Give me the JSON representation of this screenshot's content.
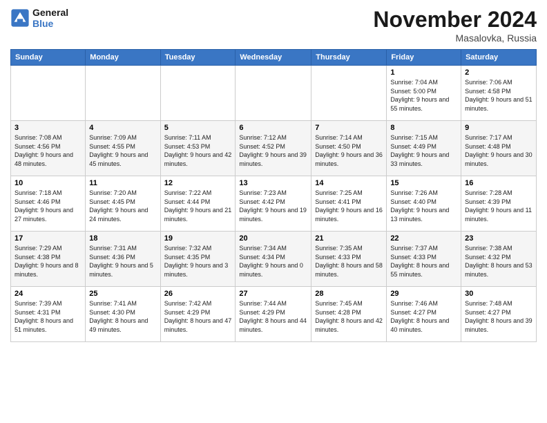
{
  "header": {
    "logo_general": "General",
    "logo_blue": "Blue",
    "month_title": "November 2024",
    "location": "Masalovka, Russia"
  },
  "weekdays": [
    "Sunday",
    "Monday",
    "Tuesday",
    "Wednesday",
    "Thursday",
    "Friday",
    "Saturday"
  ],
  "weeks": [
    [
      {
        "day": "",
        "info": ""
      },
      {
        "day": "",
        "info": ""
      },
      {
        "day": "",
        "info": ""
      },
      {
        "day": "",
        "info": ""
      },
      {
        "day": "",
        "info": ""
      },
      {
        "day": "1",
        "info": "Sunrise: 7:04 AM\nSunset: 5:00 PM\nDaylight: 9 hours and 55 minutes."
      },
      {
        "day": "2",
        "info": "Sunrise: 7:06 AM\nSunset: 4:58 PM\nDaylight: 9 hours and 51 minutes."
      }
    ],
    [
      {
        "day": "3",
        "info": "Sunrise: 7:08 AM\nSunset: 4:56 PM\nDaylight: 9 hours and 48 minutes."
      },
      {
        "day": "4",
        "info": "Sunrise: 7:09 AM\nSunset: 4:55 PM\nDaylight: 9 hours and 45 minutes."
      },
      {
        "day": "5",
        "info": "Sunrise: 7:11 AM\nSunset: 4:53 PM\nDaylight: 9 hours and 42 minutes."
      },
      {
        "day": "6",
        "info": "Sunrise: 7:12 AM\nSunset: 4:52 PM\nDaylight: 9 hours and 39 minutes."
      },
      {
        "day": "7",
        "info": "Sunrise: 7:14 AM\nSunset: 4:50 PM\nDaylight: 9 hours and 36 minutes."
      },
      {
        "day": "8",
        "info": "Sunrise: 7:15 AM\nSunset: 4:49 PM\nDaylight: 9 hours and 33 minutes."
      },
      {
        "day": "9",
        "info": "Sunrise: 7:17 AM\nSunset: 4:48 PM\nDaylight: 9 hours and 30 minutes."
      }
    ],
    [
      {
        "day": "10",
        "info": "Sunrise: 7:18 AM\nSunset: 4:46 PM\nDaylight: 9 hours and 27 minutes."
      },
      {
        "day": "11",
        "info": "Sunrise: 7:20 AM\nSunset: 4:45 PM\nDaylight: 9 hours and 24 minutes."
      },
      {
        "day": "12",
        "info": "Sunrise: 7:22 AM\nSunset: 4:44 PM\nDaylight: 9 hours and 21 minutes."
      },
      {
        "day": "13",
        "info": "Sunrise: 7:23 AM\nSunset: 4:42 PM\nDaylight: 9 hours and 19 minutes."
      },
      {
        "day": "14",
        "info": "Sunrise: 7:25 AM\nSunset: 4:41 PM\nDaylight: 9 hours and 16 minutes."
      },
      {
        "day": "15",
        "info": "Sunrise: 7:26 AM\nSunset: 4:40 PM\nDaylight: 9 hours and 13 minutes."
      },
      {
        "day": "16",
        "info": "Sunrise: 7:28 AM\nSunset: 4:39 PM\nDaylight: 9 hours and 11 minutes."
      }
    ],
    [
      {
        "day": "17",
        "info": "Sunrise: 7:29 AM\nSunset: 4:38 PM\nDaylight: 9 hours and 8 minutes."
      },
      {
        "day": "18",
        "info": "Sunrise: 7:31 AM\nSunset: 4:36 PM\nDaylight: 9 hours and 5 minutes."
      },
      {
        "day": "19",
        "info": "Sunrise: 7:32 AM\nSunset: 4:35 PM\nDaylight: 9 hours and 3 minutes."
      },
      {
        "day": "20",
        "info": "Sunrise: 7:34 AM\nSunset: 4:34 PM\nDaylight: 9 hours and 0 minutes."
      },
      {
        "day": "21",
        "info": "Sunrise: 7:35 AM\nSunset: 4:33 PM\nDaylight: 8 hours and 58 minutes."
      },
      {
        "day": "22",
        "info": "Sunrise: 7:37 AM\nSunset: 4:33 PM\nDaylight: 8 hours and 55 minutes."
      },
      {
        "day": "23",
        "info": "Sunrise: 7:38 AM\nSunset: 4:32 PM\nDaylight: 8 hours and 53 minutes."
      }
    ],
    [
      {
        "day": "24",
        "info": "Sunrise: 7:39 AM\nSunset: 4:31 PM\nDaylight: 8 hours and 51 minutes."
      },
      {
        "day": "25",
        "info": "Sunrise: 7:41 AM\nSunset: 4:30 PM\nDaylight: 8 hours and 49 minutes."
      },
      {
        "day": "26",
        "info": "Sunrise: 7:42 AM\nSunset: 4:29 PM\nDaylight: 8 hours and 47 minutes."
      },
      {
        "day": "27",
        "info": "Sunrise: 7:44 AM\nSunset: 4:29 PM\nDaylight: 8 hours and 44 minutes."
      },
      {
        "day": "28",
        "info": "Sunrise: 7:45 AM\nSunset: 4:28 PM\nDaylight: 8 hours and 42 minutes."
      },
      {
        "day": "29",
        "info": "Sunrise: 7:46 AM\nSunset: 4:27 PM\nDaylight: 8 hours and 40 minutes."
      },
      {
        "day": "30",
        "info": "Sunrise: 7:48 AM\nSunset: 4:27 PM\nDaylight: 8 hours and 39 minutes."
      }
    ]
  ]
}
